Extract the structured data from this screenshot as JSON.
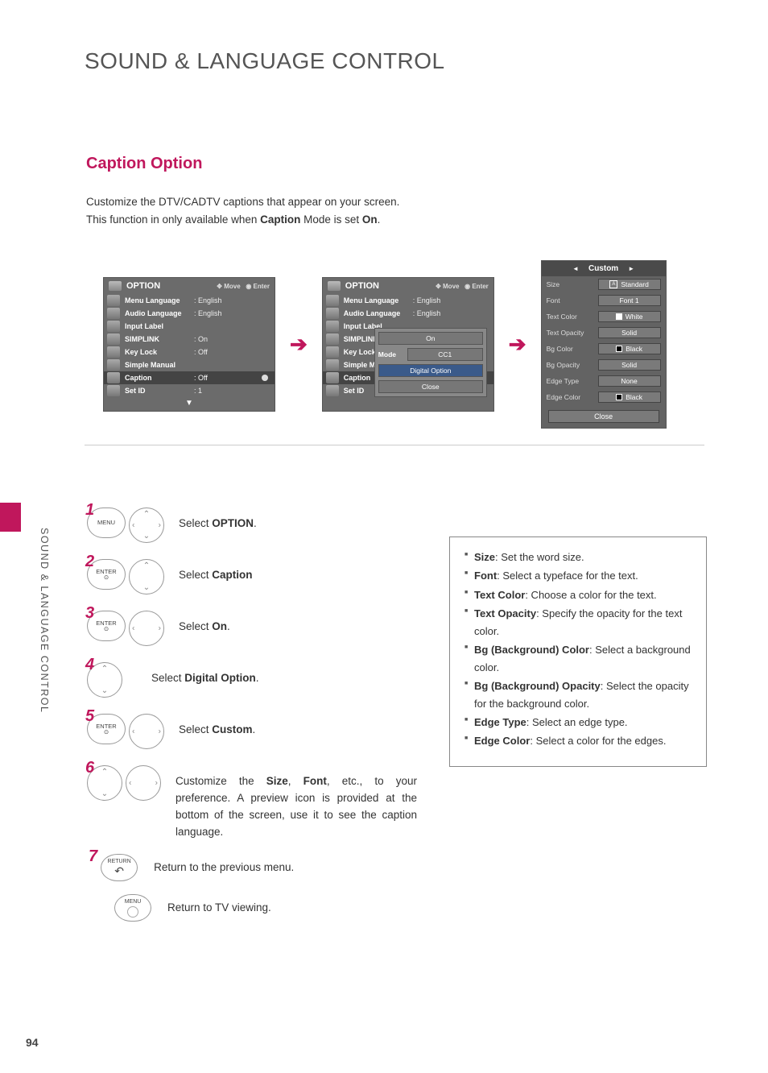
{
  "page": {
    "title": "SOUND & LANGUAGE CONTROL",
    "section": "Caption Option",
    "intro_l1": "Customize the DTV/CADTV captions that appear on your screen.",
    "intro_l2a": "This function in only available when ",
    "intro_l2b": "Caption",
    "intro_l2c": " Mode is set ",
    "intro_l2d": "On",
    "intro_l2e": ".",
    "side_tab": "SOUND & LANGUAGE CONTROL",
    "number": "94"
  },
  "osd": {
    "title": "OPTION",
    "hints_move": "Move",
    "hints_enter": "Enter",
    "rows": [
      {
        "label": "Menu Language",
        "val": ": English"
      },
      {
        "label": "Audio Language",
        "val": ": English"
      },
      {
        "label": "Input Label",
        "val": ""
      },
      {
        "label": "SIMPLINK",
        "val": ": On"
      },
      {
        "label": "Key Lock",
        "val": ": Off"
      },
      {
        "label": "Simple Manual",
        "val": ""
      },
      {
        "label": "Caption",
        "val": ": Off"
      },
      {
        "label": "Set ID",
        "val": ": 1"
      }
    ],
    "footer": "▼"
  },
  "popup": {
    "on": "On",
    "mode_label": "Mode",
    "mode_val": "CC1",
    "digital": "Digital Option",
    "close": "Close"
  },
  "custom": {
    "title": "Custom",
    "rows": [
      {
        "label": "Size",
        "val": "Standard",
        "icon": "A"
      },
      {
        "label": "Font",
        "val": "Font 1"
      },
      {
        "label": "Text Color",
        "val": "White",
        "swatch": "white"
      },
      {
        "label": "Text Opacity",
        "val": "Solid"
      },
      {
        "label": "Bg Color",
        "val": "Black",
        "swatch": "black"
      },
      {
        "label": "Bg Opacity",
        "val": "Solid"
      },
      {
        "label": "Edge Type",
        "val": "None"
      },
      {
        "label": "Edge Color",
        "val": "Black",
        "swatch": "black"
      }
    ],
    "close": "Close"
  },
  "steps": {
    "s1_pre": "Select ",
    "s1_b": "OPTION",
    "s1_post": ".",
    "s2_pre": "Select ",
    "s2_b": "Caption",
    "s3_pre": "Select ",
    "s3_b": "On",
    "s3_post": ".",
    "s4_pre": "Select ",
    "s4_b": "Digital Option",
    "s4_post": ".",
    "s5_pre": "Select ",
    "s5_b": "Custom",
    "s5_post": ".",
    "s6_a": "Customize the ",
    "s6_b": "Size",
    "s6_c": ", ",
    "s6_d": "Font",
    "s6_e": ", etc., to your preference. A preview icon is provided at the bottom of the screen, use it to see the caption language.",
    "s7": "Return to the previous menu.",
    "s8": "Return to TV viewing.",
    "btn_menu": "MENU",
    "btn_enter": "ENTER",
    "btn_return": "RETURN"
  },
  "info": {
    "i1_b": "Size",
    "i1_t": ": Set the word size.",
    "i2_b": "Font",
    "i2_t": ": Select a typeface for the text.",
    "i3_b": "Text Color",
    "i3_t": ": Choose a color for the text.",
    "i4_b": "Text Opacity",
    "i4_t": ": Specify the opacity for the text color.",
    "i5_b": "Bg (Background) Color",
    "i5_t": ": Select a background color.",
    "i6_b": "Bg (Background) Opacity",
    "i6_t": ": Select the opacity for the background color.",
    "i7_b": "Edge Type",
    "i7_t": ": Select an edge type.",
    "i8_b": "Edge Color",
    "i8_t": ": Select a color for the edges."
  }
}
